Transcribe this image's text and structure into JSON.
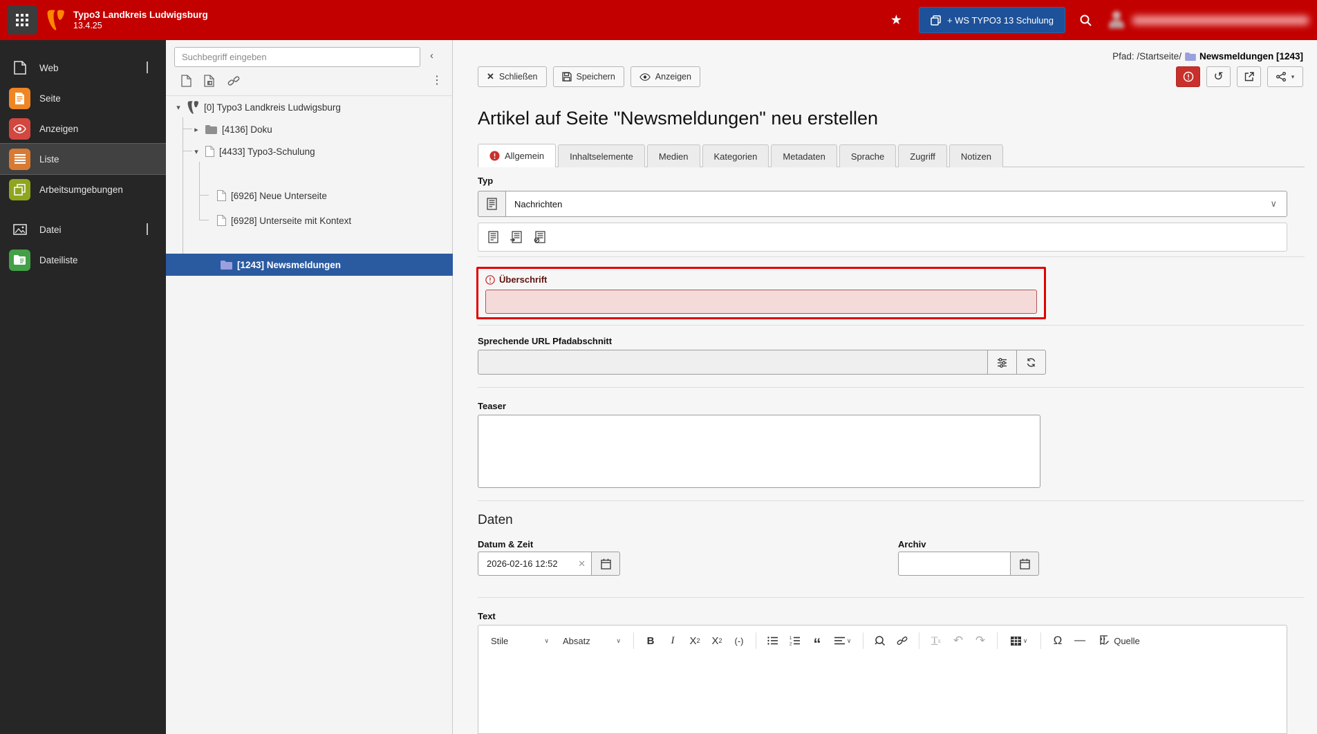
{
  "topbar": {
    "org_name": "Typo3 Landkreis Ludwigsburg",
    "version": "13.4.25",
    "workspace_button": "+ WS TYPO3 13 Schulung",
    "brand_orange": "#ff8700",
    "bar_red": "#c30000",
    "workspace_blue": "#1d5199",
    "user_redacted": true
  },
  "sidebar": {
    "groups": [
      {
        "label": "Web",
        "items": [
          {
            "label": "Seite",
            "color": "#ef8523",
            "active": false
          },
          {
            "label": "Anzeigen",
            "color": "#d2473f",
            "active": false
          },
          {
            "label": "Liste",
            "color": "#d77a33",
            "active": true
          },
          {
            "label": "Arbeitsumgebungen",
            "color": "#8ea61e",
            "active": false
          }
        ]
      },
      {
        "label": "Datei",
        "items": [
          {
            "label": "Dateiliste",
            "color": "#43a047",
            "active": false
          }
        ]
      }
    ]
  },
  "tree": {
    "search_placeholder": "Suchbegriff eingeben",
    "nodes": [
      {
        "label": "[0] Typo3 Landkreis Ludwigsburg",
        "icon": "typo3-site",
        "expanded": true
      },
      {
        "label": "[4136] Doku",
        "icon": "folder-gray",
        "collapsed": true
      },
      {
        "label": "[4433] Typo3-Schulung",
        "icon": "page",
        "expanded": true
      },
      {
        "label": "[6926] Neue Unterseite",
        "icon": "page"
      },
      {
        "label": "[6928] Unterseite mit Kontext",
        "icon": "page"
      },
      {
        "label": "[1243] Newsmeldungen",
        "icon": "folder-blue",
        "selected": true
      }
    ],
    "selected_bg": "#2a5aa0"
  },
  "docheader": {
    "breadcrumb_prefix": "Pfad: /Startseite/",
    "breadcrumb_current": "Newsmeldungen [1243]",
    "buttons": {
      "close": "Schließen",
      "save": "Speichern",
      "view": "Anzeigen"
    }
  },
  "form": {
    "title": "Artikel auf Seite \"Newsmeldungen\" neu erstellen",
    "tabs": [
      {
        "label": "Allgemein",
        "active": true,
        "has_error": true
      },
      {
        "label": "Inhaltselemente"
      },
      {
        "label": "Medien"
      },
      {
        "label": "Kategorien"
      },
      {
        "label": "Metadaten"
      },
      {
        "label": "Sprache"
      },
      {
        "label": "Zugriff"
      },
      {
        "label": "Notizen"
      }
    ],
    "typ": {
      "label": "Typ",
      "value": "Nachrichten"
    },
    "ueberschrift": {
      "label": "Überschrift",
      "value": "",
      "error": true
    },
    "slug": {
      "label": "Sprechende URL Pfadabschnitt",
      "value": ""
    },
    "teaser": {
      "label": "Teaser",
      "value": ""
    },
    "daten": {
      "heading": "Daten",
      "datetime": {
        "label": "Datum & Zeit",
        "value": "2026-02-16 12:52"
      },
      "archiv": {
        "label": "Archiv",
        "value": ""
      }
    },
    "text": {
      "label": "Text",
      "toolbar": {
        "styles": "Stile",
        "paragraph": "Absatz",
        "source": "Quelle"
      }
    }
  }
}
